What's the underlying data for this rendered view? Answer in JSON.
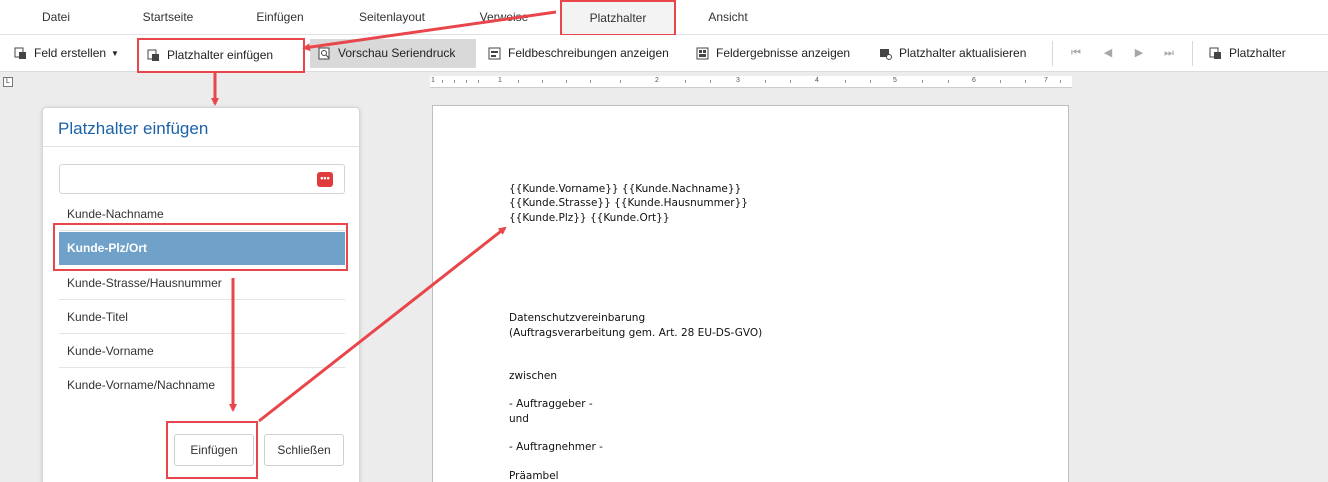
{
  "menu": {
    "items": [
      "Datei",
      "Startseite",
      "Einfügen",
      "Seitenlayout",
      "Verweise",
      "Platzhalter",
      "Ansicht"
    ],
    "active": "Platzhalter"
  },
  "toolbar": {
    "feld_erstellen": "Feld erstellen",
    "platzhalter_einfuegen": "Platzhalter einfügen",
    "vorschau_seriendruck": "Vorschau Seriendruck",
    "feldbeschreibungen": "Feldbeschreibungen anzeigen",
    "feldergebnisse": "Feldergebnisse anzeigen",
    "platzhalter_aktualisieren": "Platzhalter aktualisieren",
    "platzhalter": "Platzhalter"
  },
  "ruler": {
    "corner_glyph": "L",
    "numbers": [
      "1",
      "1",
      "2",
      "3",
      "4",
      "5",
      "6",
      "7"
    ]
  },
  "dialog": {
    "title": "Platzhalter einfügen",
    "search_value": "",
    "dots_glyph": "•••",
    "items": [
      "Kunde-Nachname",
      "Kunde-Plz/Ort",
      "Kunde-Strasse/Hausnummer",
      "Kunde-Titel",
      "Kunde-Vorname",
      "Kunde-Vorname/Nachname"
    ],
    "selected": "Kunde-Plz/Ort",
    "insert_label": "Einfügen",
    "close_label": "Schließen"
  },
  "document": {
    "lines": [
      "{{Kunde.Vorname}} {{Kunde.Nachname}}",
      "{{Kunde.Strasse}} {{Kunde.Hausnummer}}",
      "{{Kunde.Plz}} {{Kunde.Ort}}",
      "Datenschutzvereinbarung",
      "(Auftragsverarbeitung gem. Art. 28 EU-DS-GVO)",
      "zwischen",
      "- Auftraggeber -",
      "und",
      "- Auftragnehmer -",
      "Präambel"
    ]
  },
  "colors": {
    "annotation_red": "#e8464a",
    "title_blue": "#1b62a8",
    "selection_blue": "#6fa1c9"
  }
}
